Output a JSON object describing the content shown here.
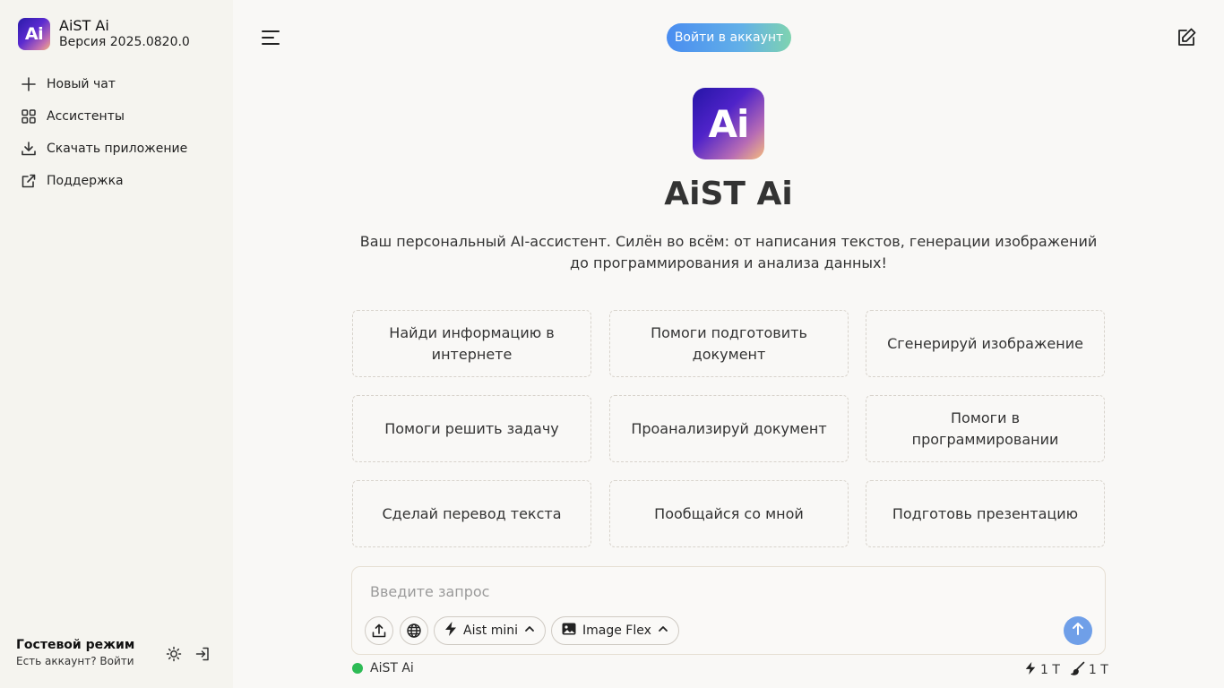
{
  "sidebar": {
    "brand_logo_text": "Ai",
    "brand_name": "AiST Ai",
    "brand_version": "Версия 2025.0820.0",
    "items": [
      {
        "label": "Новый чат",
        "icon": "plus-icon"
      },
      {
        "label": "Ассистенты",
        "icon": "grid-icon"
      },
      {
        "label": "Скачать приложение",
        "icon": "download-icon"
      },
      {
        "label": "Поддержка",
        "icon": "external-link-icon"
      }
    ],
    "guest_title": "Гостевой режим",
    "guest_subtitle": "Есть аккаунт? Войти"
  },
  "header": {
    "login_label": "Войти в аккаунт"
  },
  "hero": {
    "logo_text": "Ai",
    "title": "AiST Ai",
    "description": "Ваш персональный AI-ассистент. Силён во всём: от написания текстов, генерации изображений до программирования и анализа данных!"
  },
  "cards": [
    "Найди информацию в интернете",
    "Помоги подготовить документ",
    "Сгенерируй изображение",
    "Помоги решить задачу",
    "Проанализируй документ",
    "Помоги в программировании",
    "Сделай перевод текста",
    "Пообщайся со мной",
    "Подготовь презентацию"
  ],
  "composer": {
    "placeholder": "Введите запрос",
    "model_label": "Aist mini",
    "image_model_label": "Image Flex"
  },
  "status": {
    "model_name": "AiST Ai",
    "text_tokens": "1 Т",
    "image_tokens": "1 Т",
    "online_color": "#2dbb55"
  },
  "colors": {
    "accent": "#4a8df0",
    "send_button": "#6f9fe8"
  }
}
